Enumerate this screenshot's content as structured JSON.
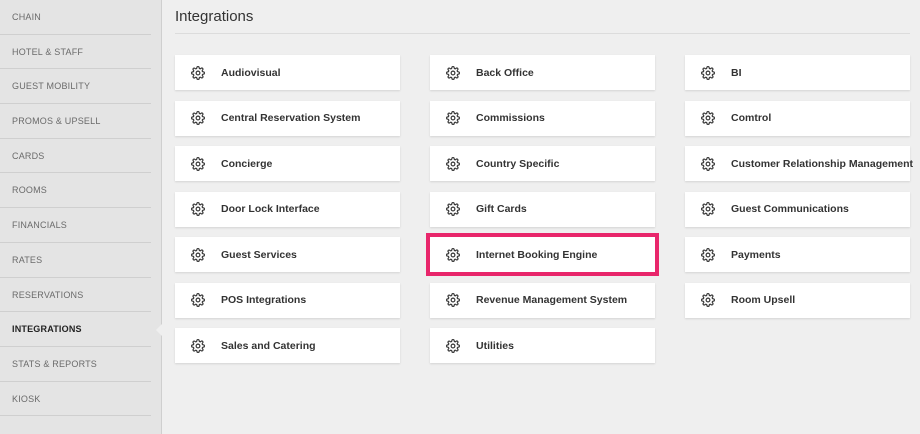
{
  "sidebar": {
    "items": [
      {
        "label": "CHAIN"
      },
      {
        "label": "HOTEL & STAFF"
      },
      {
        "label": "GUEST MOBILITY"
      },
      {
        "label": "PROMOS & UPSELL"
      },
      {
        "label": "CARDS"
      },
      {
        "label": "ROOMS"
      },
      {
        "label": "FINANCIALS"
      },
      {
        "label": "RATES"
      },
      {
        "label": "RESERVATIONS"
      },
      {
        "label": "INTEGRATIONS"
      },
      {
        "label": "STATS & REPORTS"
      },
      {
        "label": "KIOSK"
      }
    ],
    "active_item": "INTEGRATIONS"
  },
  "main": {
    "title": "Integrations",
    "cards": [
      {
        "label": "Audiovisual"
      },
      {
        "label": "Back Office"
      },
      {
        "label": "BI"
      },
      {
        "label": "Central Reservation System"
      },
      {
        "label": "Commissions"
      },
      {
        "label": "Comtrol"
      },
      {
        "label": "Concierge"
      },
      {
        "label": "Country Specific"
      },
      {
        "label": "Customer Relationship Management"
      },
      {
        "label": "Door Lock Interface"
      },
      {
        "label": "Gift Cards"
      },
      {
        "label": "Guest Communications"
      },
      {
        "label": "Guest Services"
      },
      {
        "label": "Internet Booking Engine"
      },
      {
        "label": "Payments"
      },
      {
        "label": "POS Integrations"
      },
      {
        "label": "Revenue Management System"
      },
      {
        "label": "Room Upsell"
      },
      {
        "label": "Sales and Catering"
      },
      {
        "label": "Utilities"
      }
    ],
    "highlighted_card": "Internet Booking Engine",
    "card_icon": "gear-icon"
  },
  "colors": {
    "background": "#efefef",
    "sidebar": "#e4e4e4",
    "highlight": "#e8266b"
  }
}
